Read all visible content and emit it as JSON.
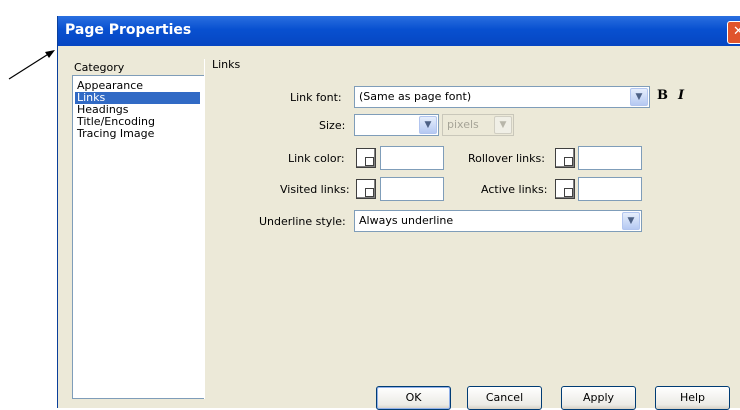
{
  "dialog": {
    "title": "Page Properties",
    "close_glyph": "✕"
  },
  "category": {
    "header": "Category",
    "items": [
      "Appearance",
      "Links",
      "Headings",
      "Title/Encoding",
      "Tracing Image"
    ],
    "selected": "Links"
  },
  "panel": {
    "header": "Links",
    "link_font": {
      "label": "Link font:",
      "value": "(Same as page font)"
    },
    "bold_label": "B",
    "italic_label": "I",
    "size": {
      "label": "Size:",
      "value": "",
      "unit": "pixels"
    },
    "link_color": {
      "label": "Link color:",
      "value": ""
    },
    "rollover_links": {
      "label": "Rollover links:",
      "value": ""
    },
    "visited_links": {
      "label": "Visited links:",
      "value": ""
    },
    "active_links": {
      "label": "Active links:",
      "value": ""
    },
    "underline_style": {
      "label": "Underline style:",
      "value": "Always underline"
    }
  },
  "buttons": {
    "ok": "OK",
    "cancel": "Cancel",
    "apply": "Apply",
    "help": "Help"
  },
  "icons": [
    "arrow-annotation",
    "close-icon",
    "chevron-down-icon",
    "color-swatch-icon"
  ],
  "colors": {
    "titlebar": "#0850d0",
    "selection": "#316ac5",
    "dialog_bg": "#ece9d8"
  }
}
